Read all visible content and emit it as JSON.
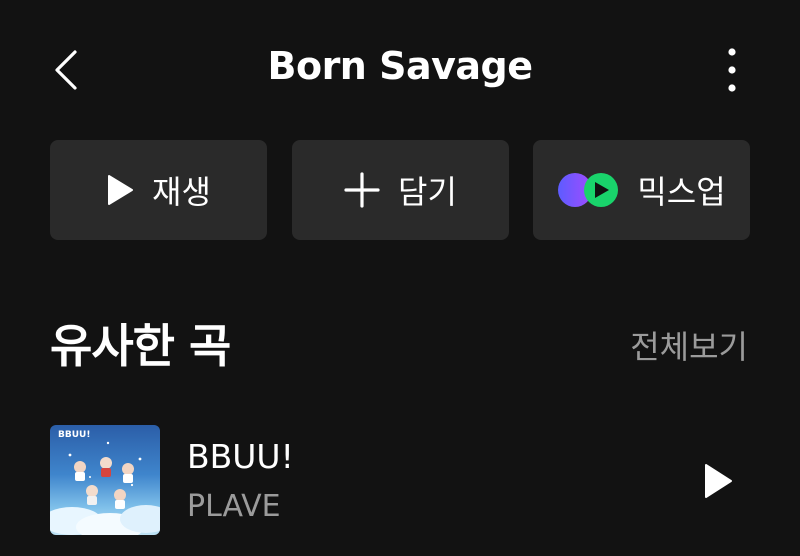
{
  "header": {
    "title": "Born Savage",
    "back_icon": "chevron-left-icon",
    "more_icon": "more-vertical-icon"
  },
  "actions": [
    {
      "label": "재생",
      "icon": "play-icon"
    },
    {
      "label": "담기",
      "icon": "plus-icon"
    },
    {
      "label": "믹스업",
      "icon": "mixup-icon"
    }
  ],
  "similar": {
    "title": "유사한 곡",
    "see_all": "전체보기",
    "tracks": [
      {
        "title": "BBUU!",
        "artist": "PLAVE",
        "cover_text": "BBUU!"
      }
    ]
  },
  "colors": {
    "background": "#121212",
    "button_bg": "#2a2a2a",
    "secondary_text": "#9b9b9b",
    "mixup_purple": "#7a4cff",
    "mixup_green": "#19d36b"
  }
}
